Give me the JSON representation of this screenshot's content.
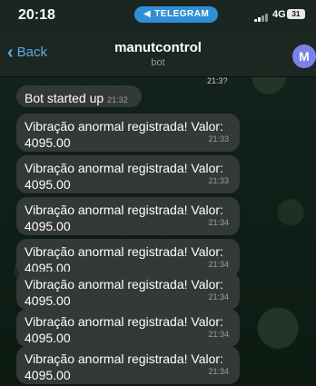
{
  "status": {
    "time": "20:18",
    "app_pill": "TELEGRAM",
    "network": "4G",
    "battery": "31"
  },
  "header": {
    "back_label": "Back",
    "title": "manutcontrol",
    "subtitle": "bot",
    "avatar_letter": "M"
  },
  "chat": {
    "peek_time": "21:3?",
    "messages": [
      {
        "text": "Bot started up",
        "time": "21:32"
      },
      {
        "text": "Vibração anormal registrada! Valor: 4095.00",
        "time": "21:33"
      },
      {
        "text": "Vibração anormal registrada! Valor: 4095.00",
        "time": "21:33"
      },
      {
        "text": "Vibração anormal registrada! Valor: 4095.00",
        "time": "21:34"
      },
      {
        "text": "Vibração anormal registrada! Valor: 4095.00",
        "time": "21:34"
      },
      {
        "text": "Vibração anormal registrada! Valor: 4095.00",
        "time": "21:34"
      },
      {
        "text": "Vibração anormal registrada! Valor: 4095.00",
        "time": "21:34"
      },
      {
        "text": "Vibração anormal registrada! Valor: 4095.00",
        "time": "21:34"
      }
    ]
  }
}
